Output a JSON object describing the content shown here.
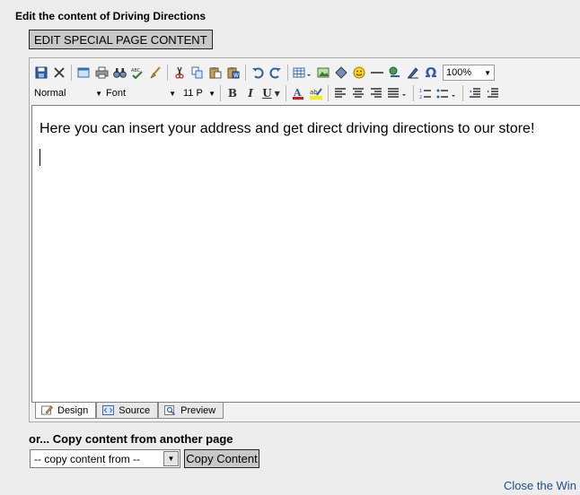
{
  "page": {
    "heading": "Edit the content of Driving Directions",
    "special_button": "EDIT SPECIAL PAGE CONTENT"
  },
  "toolbar": {
    "zoom": "100%",
    "format_select": "Normal",
    "font_select": "Font",
    "size_select": "11 P",
    "icons": [
      "save-icon",
      "cancel-icon",
      "fullscreen-icon",
      "print-icon",
      "find-icon",
      "spellcheck-icon",
      "clean-icon",
      "cut-icon",
      "copy-icon",
      "paste-icon",
      "paste-word-icon",
      "undo-icon",
      "redo-icon",
      "table-icon",
      "image-icon",
      "anchor-icon",
      "emoticon-icon",
      "horizontal-rule-icon",
      "hyperlink-icon",
      "style-icon",
      "special-char-icon",
      "bold-icon",
      "italic-icon",
      "underline-icon",
      "font-color-icon",
      "highlight-icon",
      "align-left-icon",
      "align-center-icon",
      "align-right-icon",
      "justify-icon",
      "ordered-list-icon",
      "unordered-list-icon",
      "outdent-icon",
      "indent-icon"
    ]
  },
  "editor": {
    "content": "Here you can insert your address and get direct driving directions to our store!"
  },
  "tabs": [
    {
      "label": "Design"
    },
    {
      "label": "Source"
    },
    {
      "label": "Preview"
    }
  ],
  "copy": {
    "label": "or... Copy content from another page",
    "select_value": "-- copy content from --",
    "button": "Copy Content"
  },
  "footer": {
    "close_link": "Close the Win"
  }
}
